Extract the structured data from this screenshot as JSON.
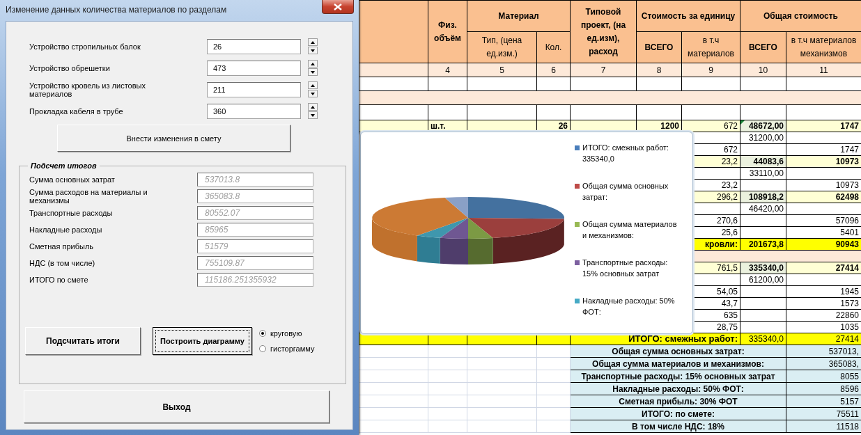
{
  "dialog": {
    "title": "Изменение данных количества материалов по разделам",
    "inputs": [
      {
        "label": "Устройство стропильных балок",
        "value": "26"
      },
      {
        "label": "Устройство обрешетки",
        "value": "473"
      },
      {
        "label": "Устройство кровель из листовых материалов",
        "value": "211"
      },
      {
        "label": "Прокладка кабеля в трубе",
        "value": "360"
      }
    ],
    "apply_button": "Внести изменения в смету",
    "totals_group": {
      "title": "Подсчет итогов",
      "fields": [
        {
          "label": "Сумма основных затрат",
          "value": "537013.8",
          "disabled": true
        },
        {
          "label": "Сумма расходов на материалы и механизмы",
          "value": "365083.8",
          "disabled": true
        },
        {
          "label": "Транспортные расходы",
          "value": "80552.07",
          "disabled": true
        },
        {
          "label": "Накладные расходы",
          "value": "85965",
          "disabled": true
        },
        {
          "label": "Сметная прибыль",
          "value": "51579",
          "disabled": true
        },
        {
          "label": "НДС (в том числе)",
          "value": "755109.87",
          "disabled": true
        },
        {
          "label": "ИТОГО по смете",
          "value": "115186.251355932",
          "disabled": true
        }
      ]
    },
    "calc_button": {
      "label": "Подсчитать итоги",
      "focused": false
    },
    "chart_button": {
      "label": "Построить диаграмму",
      "focused": true
    },
    "chart_types": [
      {
        "label": "круговую",
        "selected": true
      },
      {
        "label": "гисторгамму",
        "selected": false
      }
    ],
    "exit_button": "Выход"
  },
  "sheet": {
    "header": {
      "volume": "Физ. объём",
      "material": "Материал",
      "material_type": "Тип, (цена ед.изм.)",
      "material_qty": "Кол.",
      "typical": "Типовой проект, (на ед.изм), расход",
      "unit_cost": "Стоимость за единицу",
      "unit_total": "ВСЕГО",
      "unit_materials": "в т.ч материалов",
      "total_cost": "Общая стоимость",
      "total": "ВСЕГО",
      "total_materials": "в т.ч материалов механизмов"
    },
    "column_numbers": [
      "4",
      "5",
      "6",
      "7",
      "8",
      "9",
      "10",
      "11"
    ],
    "rows": [
      {
        "kind": "item"
      },
      {
        "kind": "band"
      },
      {
        "kind": "item"
      },
      {
        "kind": "subtotal",
        "comment_marker": true,
        "cells": {
          "vol": "ш.т.",
          "qty": "26",
          "unit_total": "1200",
          "unit_mat": "672",
          "total": "48672,00",
          "total_mat": "1747"
        }
      },
      {
        "kind": "item",
        "cells": {
          "total": "31200,00"
        }
      },
      {
        "kind": "item",
        "cells": {
          "unit_mat": "672",
          "total_mat": "1747"
        }
      },
      {
        "kind": "subtotal",
        "cells": {
          "unit_mat": "23,2",
          "total": "44083,6",
          "total_mat": "10973"
        }
      },
      {
        "kind": "item",
        "cells": {
          "total": "33110,00"
        }
      },
      {
        "kind": "item",
        "cells": {
          "unit_mat": "23,2",
          "total_mat": "10973"
        }
      },
      {
        "kind": "subtotal",
        "cells": {
          "unit_mat": "296,2",
          "total": "108918,2",
          "total_mat": "62498"
        }
      },
      {
        "kind": "item",
        "cells": {
          "total": "46420,00"
        }
      },
      {
        "kind": "item",
        "cells": {
          "unit_mat": "270,6",
          "total_mat": "57096"
        }
      },
      {
        "kind": "item",
        "cells": {
          "unit_mat": "25,6",
          "total_mat": "5401"
        }
      },
      {
        "kind": "section_total",
        "cells": {
          "unit_mat": "кровли:",
          "total": "201673,8",
          "total_mat": "90943"
        }
      },
      {
        "kind": "band"
      },
      {
        "kind": "subtotal",
        "cells": {
          "unit_mat": "761,5",
          "total": "335340,0",
          "total_mat": "27414"
        }
      },
      {
        "kind": "item",
        "cells": {
          "total": "61200,00"
        }
      },
      {
        "kind": "item",
        "cells": {
          "unit_mat": "54,05",
          "total_mat": "1945"
        }
      },
      {
        "kind": "item",
        "cells": {
          "unit_mat": "43,7",
          "total_mat": "1573"
        }
      },
      {
        "kind": "item",
        "cells": {
          "unit_mat": "635",
          "total_mat": "22860"
        }
      },
      {
        "kind": "item",
        "cells": {
          "unit_mat": "28,75",
          "total_mat": "1035"
        }
      },
      {
        "kind": "grand_total",
        "cells": {
          "label": "ИТОГО: смежных работ:",
          "total": "335340,0",
          "total_mat": "27414"
        }
      }
    ],
    "summary": [
      {
        "label": "Общая сумма основных затрат:",
        "value": "537013,"
      },
      {
        "label": "Общая сумма материалов и механизмов:",
        "value": "365083,"
      },
      {
        "label": "Транспортные расходы: 15% основных затрат",
        "value": "8055"
      },
      {
        "label": "Накладные расходы: 50% ФОТ:",
        "value": "8596"
      },
      {
        "label": "Сметная прибыль: 30% ФОТ",
        "value": "5157"
      },
      {
        "label": "ИТОГО: по смете:",
        "value": "75511"
      },
      {
        "label": "В том числе НДС: 18%",
        "value": "11518"
      }
    ]
  },
  "chart": {
    "legend": [
      {
        "label": "ИТОГО: смежных работ: 335340,0",
        "color": "#4a7ebb"
      },
      {
        "label": "Общая сумма основных затрат:",
        "color": "#be4b48"
      },
      {
        "label": "Общая сумма материалов и механизмов:",
        "color": "#98b954"
      },
      {
        "label": "Транспортные расходы: 15% основных затрат",
        "color": "#7d60a0"
      },
      {
        "label": "Накладные расходы: 50% ФОТ:",
        "color": "#46aac5"
      }
    ]
  }
}
